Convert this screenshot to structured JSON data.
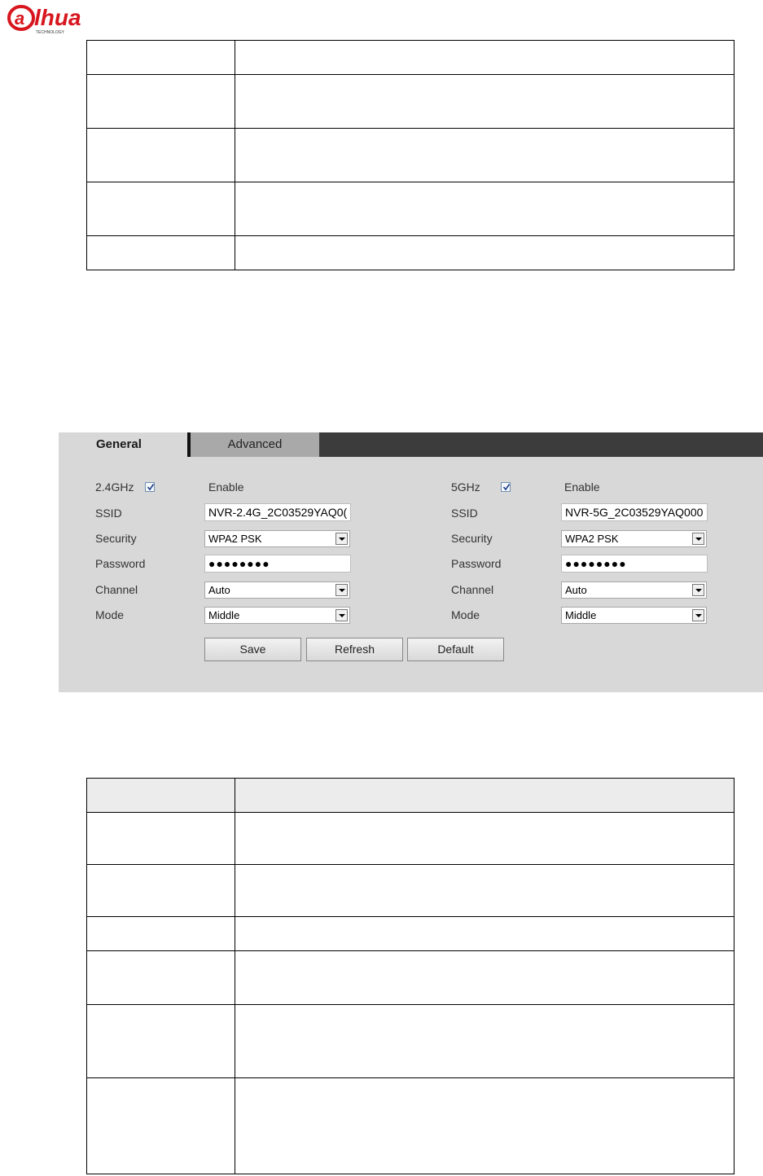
{
  "logo": {
    "brand": "alhua",
    "tagline": "TECHNOLOGY"
  },
  "top_table": {
    "rows": [
      "",
      "",
      "",
      "",
      ""
    ]
  },
  "wifi": {
    "tabs": {
      "general": "General",
      "advanced": "Advanced"
    },
    "enable_label": "Enable",
    "labels": {
      "ssid": "SSID",
      "security": "Security",
      "password": "Password",
      "channel": "Channel",
      "mode": "Mode"
    },
    "band_24": {
      "name": "2.4GHz",
      "enabled": true,
      "ssid": "NVR-2.4G_2C03529YAQ0(",
      "security": "WPA2 PSK",
      "password": "●●●●●●●●",
      "channel": "Auto",
      "mode": "Middle"
    },
    "band_5": {
      "name": "5GHz",
      "enabled": true,
      "ssid": "NVR-5G_2C03529YAQ000",
      "security": "WPA2 PSK",
      "password": "●●●●●●●●",
      "channel": "Auto",
      "mode": "Middle"
    },
    "buttons": {
      "save": "Save",
      "refresh": "Refresh",
      "default": "Default"
    }
  },
  "bottom_table": {
    "rows": [
      "",
      "",
      "",
      "",
      "",
      ""
    ]
  }
}
